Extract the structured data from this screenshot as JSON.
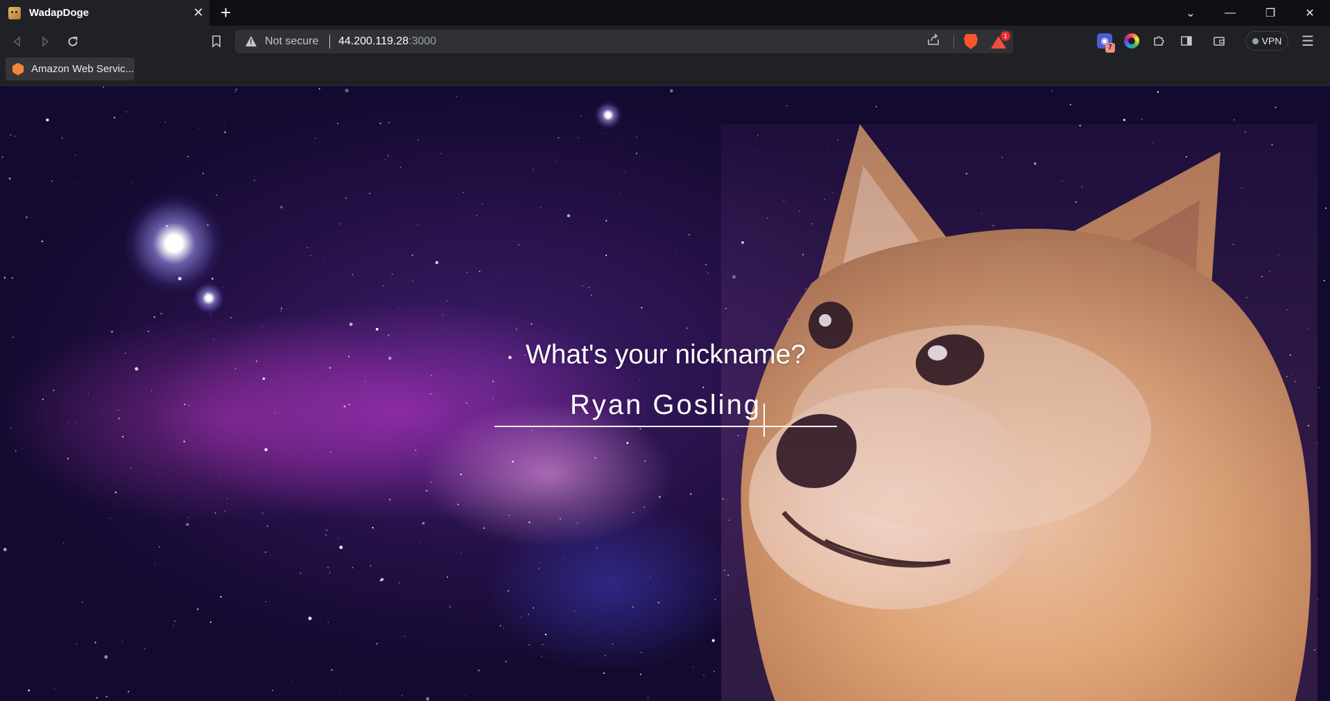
{
  "browser": {
    "tab": {
      "title": "WadapDoge",
      "favicon": "doge-favicon"
    },
    "address": {
      "security_label": "Not secure",
      "host": "44.200.119.28",
      "port": ":3000"
    },
    "rewards_badge": "1",
    "extension_badge": "7",
    "vpn_label": "VPN",
    "bookmarks": [
      {
        "label": "Amazon Web Servic...",
        "icon": "aws-icon"
      }
    ]
  },
  "page": {
    "prompt": "What's your nickname?",
    "nickname_value": "Ryan Gosling",
    "nickname_placeholder": ""
  },
  "colors": {
    "text": "#ffffff",
    "chrome_bg": "#202124",
    "titlebar_bg": "#0f0f14"
  }
}
